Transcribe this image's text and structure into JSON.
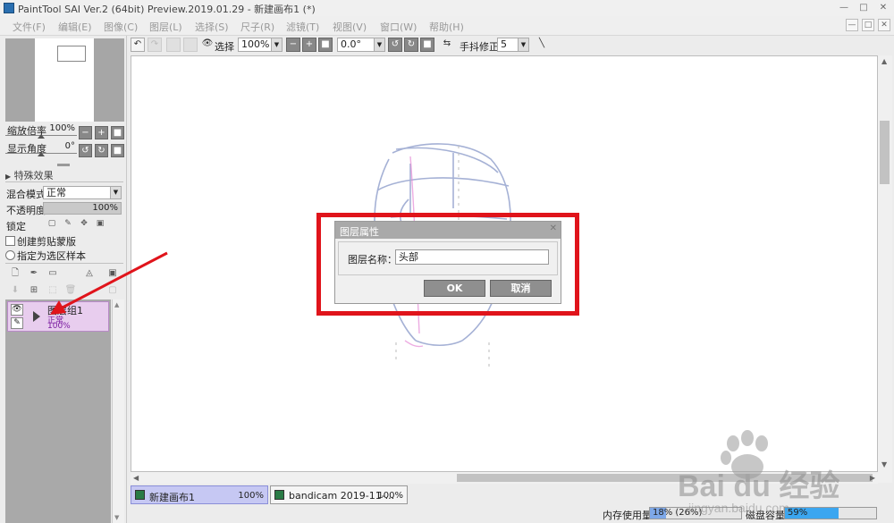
{
  "window": {
    "title": "PaintTool SAI Ver.2 (64bit) Preview.2019.01.29 - 新建画布1 (*)",
    "minimize": "—",
    "maximize": "□",
    "close": "✕"
  },
  "menu": [
    "文件(F)",
    "编辑(E)",
    "图像(C)",
    "图层(L)",
    "选择(S)",
    "尺子(R)",
    "滤镜(T)",
    "视图(V)",
    "窗口(W)",
    "帮助(H)"
  ],
  "toolbar": {
    "selection_label": "选择",
    "zoom": "100%",
    "rotation": "0.0°",
    "stabilizer_label": "手抖修正",
    "stabilizer_value": "5"
  },
  "navigator": {
    "zoom_label": "缩放倍率",
    "zoom_value": "100%",
    "zoom_level": 0.5,
    "angle_label": "显示角度",
    "angle_value": "0°",
    "angle_level": 0.5
  },
  "properties": {
    "effects_label": "特殊效果",
    "blend_label": "混合模式",
    "blend_value": "正常",
    "opacity_label": "不透明度",
    "opacity_value": "100%",
    "lock_label": "锁定",
    "clipping_label": "创建剪贴蒙版",
    "sample_label": "指定为选区样本"
  },
  "layers": [
    {
      "name": "图层组1",
      "mode": "正常",
      "opacity": "100%",
      "selected": true
    }
  ],
  "dialog": {
    "title": "图层属性",
    "name_label": "图层名称：",
    "name_value": "头部",
    "ok": "OK",
    "cancel": "取消"
  },
  "tabs": [
    {
      "name": "新建画布1",
      "zoom": "100%",
      "active": true
    },
    {
      "name": "bandicam 2019-11-...",
      "zoom": "100%",
      "active": false
    }
  ],
  "status": {
    "memory_label": "内存使用量",
    "memory_value": "18% (26%)",
    "memory_fraction": 0.18,
    "disk_label": "磁盘容量",
    "disk_value": "59%",
    "disk_fraction": 0.59
  },
  "watermark": {
    "text": "Bai du 经验",
    "url": "jingyan.baidu.com"
  },
  "colors": {
    "highlight_box": "#e0141b",
    "annotation_arrow": "#e0141b",
    "layer_selected": "#e8cdee",
    "tab_active": "#c6c8f3",
    "memory_fill": "#7ea8e8",
    "disk_fill": "#3ba6f0",
    "sketch_blue": "#8797c8",
    "sketch_pink": "#e58ad6"
  }
}
